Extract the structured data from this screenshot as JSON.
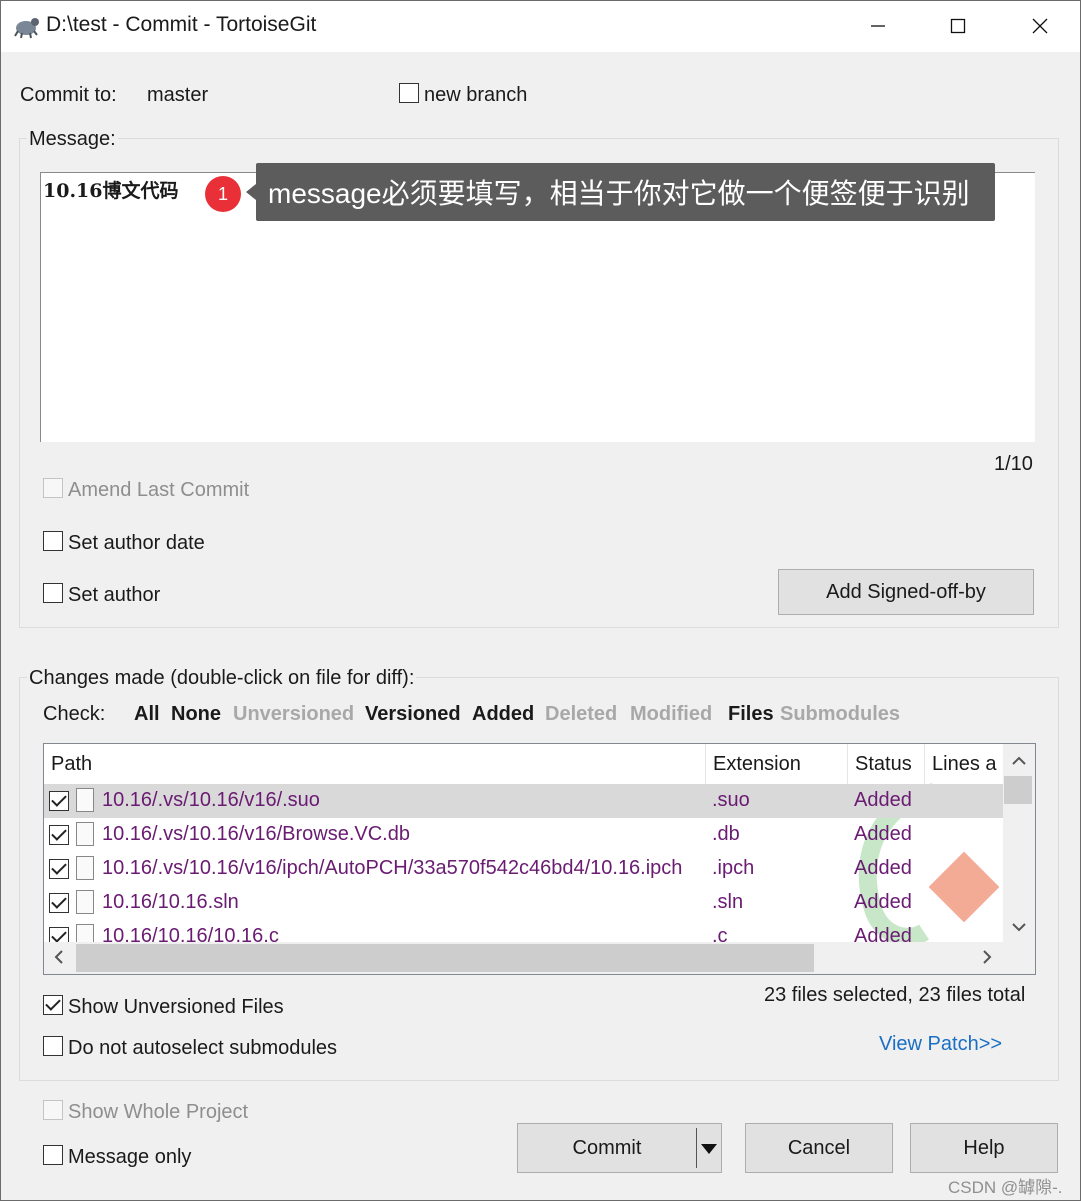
{
  "window": {
    "title": "D:\\test - Commit - TortoiseGit",
    "minimize_icon": "minimize-icon",
    "maximize_icon": "maximize-icon",
    "close_icon": "close-icon"
  },
  "commit_to": {
    "label": "Commit to:",
    "branch": "master",
    "new_branch_label": "new branch",
    "new_branch_checked": false
  },
  "message": {
    "group_label": "Message:",
    "text": "10.16博文代码",
    "counter": "1/10",
    "annotation_badge": "1",
    "annotation_text": "message必须要填写，相当于你对它做一个便签便于识别",
    "amend_label": "Amend Last Commit",
    "set_author_date_label": "Set author date",
    "set_author_label": "Set author",
    "signed_off_button": "Add Signed-off-by"
  },
  "changes": {
    "group_label": "Changes made (double-click on file for diff):",
    "check_label": "Check:",
    "check_options": [
      {
        "label": "All",
        "enabled": true
      },
      {
        "label": "None",
        "enabled": true
      },
      {
        "label": "Unversioned",
        "enabled": false
      },
      {
        "label": "Versioned",
        "enabled": true
      },
      {
        "label": "Added",
        "enabled": true
      },
      {
        "label": "Deleted",
        "enabled": false
      },
      {
        "label": "Modified",
        "enabled": false
      },
      {
        "label": "Files",
        "enabled": true
      },
      {
        "label": "Submodules",
        "enabled": false
      }
    ],
    "columns": [
      "Path",
      "Extension",
      "Status",
      "Lines a"
    ],
    "rows": [
      {
        "path": "10.16/.vs/10.16/v16/.suo",
        "ext": ".suo",
        "status": "Added",
        "checked": true,
        "selected": true
      },
      {
        "path": "10.16/.vs/10.16/v16/Browse.VC.db",
        "ext": ".db",
        "status": "Added",
        "checked": true
      },
      {
        "path": "10.16/.vs/10.16/v16/ipch/AutoPCH/33a570f542c46bd4/10.16.ipch",
        "ext": ".ipch",
        "status": "Added",
        "checked": true
      },
      {
        "path": "10.16/10.16.sln",
        "ext": ".sln",
        "status": "Added",
        "checked": true
      },
      {
        "path": "10.16/10.16/10.16.c",
        "ext": ".c",
        "status": "Added",
        "checked": true
      }
    ],
    "selection_summary": "23 files selected, 23 files total",
    "show_unversioned_label": "Show Unversioned Files",
    "show_unversioned_checked": true,
    "no_autoselect_label": "Do not autoselect submodules",
    "view_patch_link": "View Patch>>"
  },
  "footer": {
    "show_whole_project_label": "Show Whole Project",
    "message_only_label": "Message only",
    "commit_button": "Commit",
    "cancel_button": "Cancel",
    "help_button": "Help",
    "watermark": "CSDN @罅隙-."
  },
  "colors": {
    "link": "#1a6fc4",
    "file_text": "#6a1b72",
    "tooltip_bg": "#5c5c5c",
    "badge": "#e93038"
  }
}
